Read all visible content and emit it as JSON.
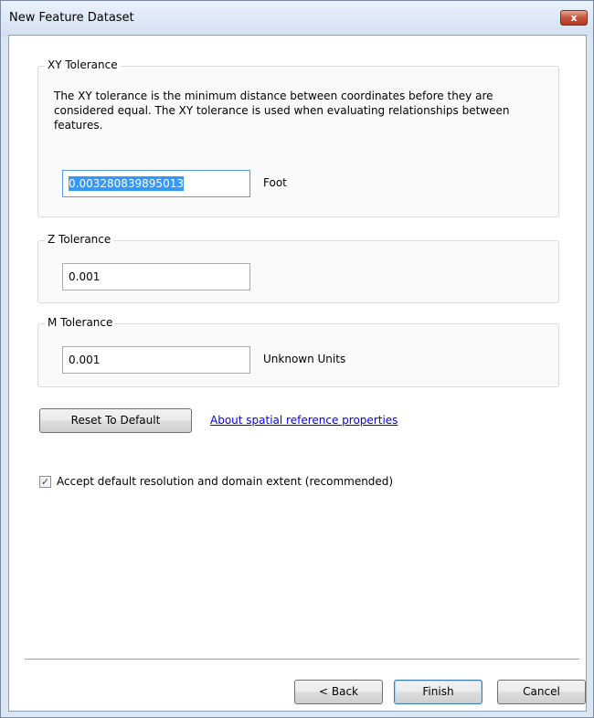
{
  "window": {
    "title": "New Feature Dataset",
    "close_glyph": "x"
  },
  "xy_tolerance": {
    "label": "XY Tolerance",
    "description": "The XY tolerance is the minimum distance between coordinates before they are considered equal. The XY tolerance is used when evaluating relationships between features.",
    "value": "0.003280839895013",
    "unit": "Foot"
  },
  "z_tolerance": {
    "label": "Z Tolerance",
    "value": "0.001"
  },
  "m_tolerance": {
    "label": "M Tolerance",
    "value": "0.001",
    "unit": "Unknown Units"
  },
  "actions": {
    "reset_label": "Reset To Default",
    "about_link": "About spatial reference properties"
  },
  "accept_default": {
    "label": "Accept default resolution and domain extent (recommended)",
    "checked": true,
    "check_glyph": "✓"
  },
  "footer": {
    "back_label": "< Back",
    "finish_label": "Finish",
    "cancel_label": "Cancel"
  },
  "icons": {
    "close": "close-icon",
    "checkbox": "checkmark-icon"
  }
}
